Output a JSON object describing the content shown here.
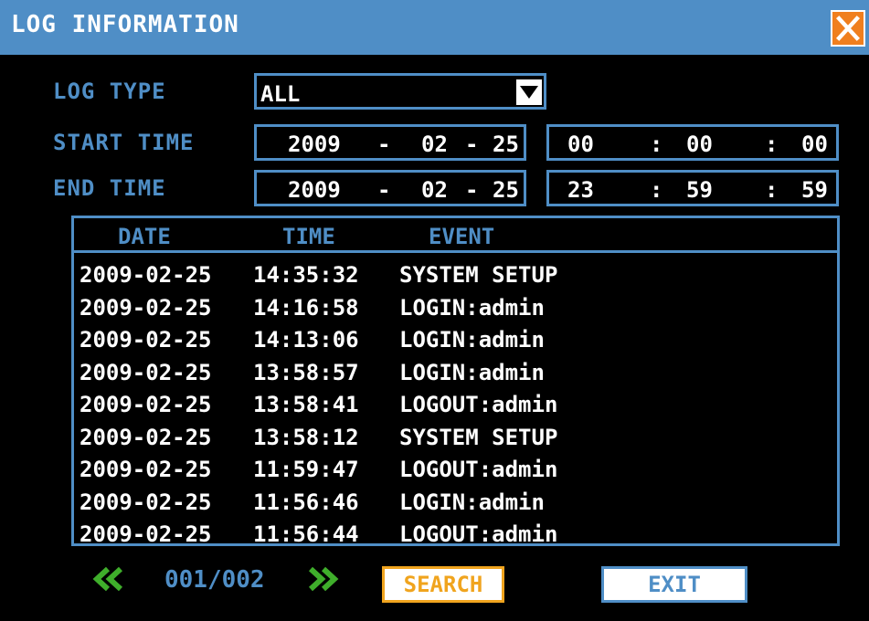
{
  "window": {
    "title": "LOG INFORMATION"
  },
  "form": {
    "log_type": {
      "label": "LOG TYPE",
      "value": "ALL"
    },
    "start_time": {
      "label": "START TIME",
      "year": "2009",
      "month": "02",
      "day": "25",
      "hour": "00",
      "minute": "00",
      "second": "00"
    },
    "end_time": {
      "label": "END TIME",
      "year": "2009",
      "month": "02",
      "day": "25",
      "hour": "23",
      "minute": "59",
      "second": "59"
    },
    "date_sep": "-",
    "time_sep": ":"
  },
  "table": {
    "headers": {
      "date": "DATE",
      "time": "TIME",
      "event": "EVENT"
    },
    "rows": [
      {
        "date": "2009-02-25",
        "time": "14:35:32",
        "event": "SYSTEM SETUP"
      },
      {
        "date": "2009-02-25",
        "time": "14:16:58",
        "event": "LOGIN:admin"
      },
      {
        "date": "2009-02-25",
        "time": "14:13:06",
        "event": "LOGIN:admin"
      },
      {
        "date": "2009-02-25",
        "time": "13:58:57",
        "event": "LOGIN:admin"
      },
      {
        "date": "2009-02-25",
        "time": "13:58:41",
        "event": "LOGOUT:admin"
      },
      {
        "date": "2009-02-25",
        "time": "13:58:12",
        "event": "SYSTEM SETUP"
      },
      {
        "date": "2009-02-25",
        "time": "11:59:47",
        "event": "LOGOUT:admin"
      },
      {
        "date": "2009-02-25",
        "time": "11:56:46",
        "event": "LOGIN:admin"
      },
      {
        "date": "2009-02-25",
        "time": "11:56:44",
        "event": "LOGOUT:admin"
      }
    ]
  },
  "pagination": {
    "page_text": "001/002"
  },
  "buttons": {
    "search": "SEARCH",
    "exit": "EXIT"
  },
  "icons": {
    "close": "close-icon",
    "dropdown": "chevron-down-icon",
    "prev": "double-chevron-left-icon",
    "next": "double-chevron-right-icon"
  },
  "colors": {
    "accent_blue": "#4f8ec6",
    "close_orange": "#f07f1e",
    "nav_green": "#3fae2b",
    "search_orange": "#f0a41e"
  }
}
